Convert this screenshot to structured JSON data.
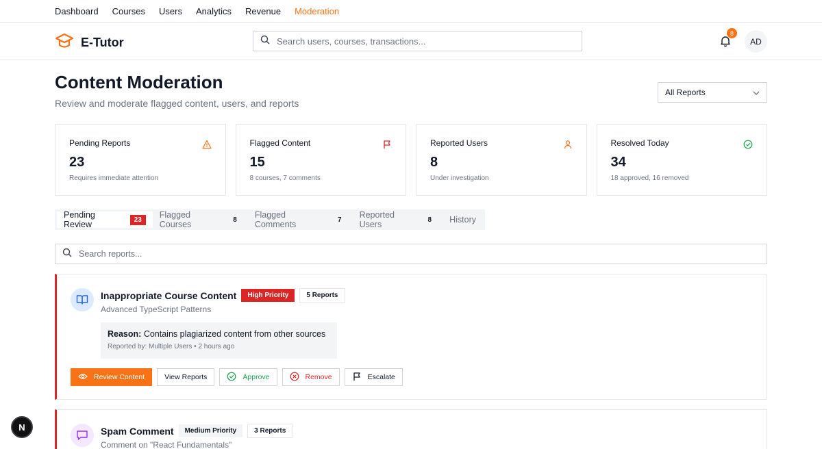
{
  "nav": {
    "items": [
      {
        "label": "Dashboard"
      },
      {
        "label": "Courses"
      },
      {
        "label": "Users"
      },
      {
        "label": "Analytics"
      },
      {
        "label": "Revenue"
      },
      {
        "label": "Moderation"
      }
    ],
    "active": "Moderation"
  },
  "header": {
    "brand": "E-Tutor",
    "search_placeholder": "Search users, courses, transactions...",
    "notification_count": "8",
    "avatar_initials": "AD"
  },
  "page": {
    "title": "Content Moderation",
    "subtitle": "Review and moderate flagged content, users, and reports",
    "filter_selected": "All Reports"
  },
  "stats": [
    {
      "label": "Pending Reports",
      "value": "23",
      "note": "Requires immediate attention",
      "icon": "warning-icon",
      "color": "#f97316"
    },
    {
      "label": "Flagged Content",
      "value": "15",
      "note": "8 courses, 7 comments",
      "icon": "flag-icon",
      "color": "#dc2626"
    },
    {
      "label": "Reported Users",
      "value": "8",
      "note": "Under investigation",
      "icon": "user-icon",
      "color": "#f97316"
    },
    {
      "label": "Resolved Today",
      "value": "34",
      "note": "18 approved, 16 removed",
      "icon": "check-circle-icon",
      "color": "#16a34a"
    }
  ],
  "tabs": [
    {
      "label": "Pending Review",
      "count": "23"
    },
    {
      "label": "Flagged Courses",
      "count": "8"
    },
    {
      "label": "Flagged Comments",
      "count": "7"
    },
    {
      "label": "Reported Users",
      "count": "8"
    },
    {
      "label": "History",
      "count": ""
    }
  ],
  "report_search_placeholder": "Search reports...",
  "reports": [
    {
      "title": "Inappropriate Course Content",
      "priority": "High Priority",
      "report_count": "5 Reports",
      "subject": "Advanced TypeScript Patterns",
      "reason_label": "Reason:",
      "reason": "Contains plagiarized content from other sources",
      "meta": "Reported by: Multiple Users • 2 hours ago",
      "icon": "book-icon"
    },
    {
      "title": "Spam Comment",
      "priority": "Medium Priority",
      "report_count": "3 Reports",
      "subject": "Comment on \"React Fundamentals\"",
      "icon": "message-icon"
    }
  ],
  "actions": {
    "review": "Review Content",
    "view": "View Reports",
    "approve": "Approve",
    "remove": "Remove",
    "escalate": "Escalate"
  },
  "fab_label": "N",
  "colors": {
    "accent": "#f97316",
    "danger": "#dc2626",
    "success": "#16a34a",
    "info": "#2563eb",
    "purple": "#9333ea"
  }
}
